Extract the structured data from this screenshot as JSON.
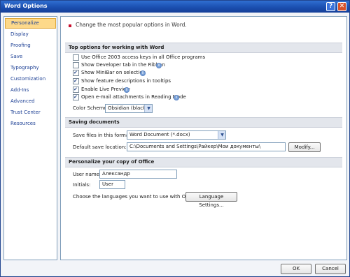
{
  "window": {
    "title": "Word Options",
    "help_label": "?",
    "close_label": "✕"
  },
  "sidebar": {
    "items": [
      {
        "label": "Personalize"
      },
      {
        "label": "Display"
      },
      {
        "label": "Proofing"
      },
      {
        "label": "Save"
      },
      {
        "label": "Typography"
      },
      {
        "label": "Customization"
      },
      {
        "label": "Add-Ins"
      },
      {
        "label": "Advanced"
      },
      {
        "label": "Trust Center"
      },
      {
        "label": "Resources"
      }
    ],
    "active_index": 0
  },
  "intro": "Change the most popular options in Word.",
  "top_options": {
    "heading": "Top options for working with Word",
    "checkboxes": [
      {
        "label": "Use Office 2003 access keys in all Office programs",
        "checked": false,
        "info": false
      },
      {
        "label": "Show Developer tab in the Ribbon",
        "checked": false,
        "info": true
      },
      {
        "label": "Show MiniBar on selection",
        "checked": true,
        "info": true
      },
      {
        "label": "Show feature descriptions in tooltips",
        "checked": true,
        "info": false
      },
      {
        "label": "Enable Live Preview",
        "checked": true,
        "info": true
      },
      {
        "label": "Open e-mail attachments in Reading Mode",
        "checked": true,
        "info": true
      }
    ],
    "color_scheme_label": "Color Scheme:",
    "color_scheme_value": "Obsidian (black)"
  },
  "saving": {
    "heading": "Saving documents",
    "format_label": "Save files in this format:",
    "format_value": "Word Document (*.docx)",
    "location_label": "Default save location:",
    "location_value": "C:\\Documents and Settings\\Райкер\\Мои документы\\",
    "modify_label": "Modify..."
  },
  "personalize": {
    "heading": "Personalize your copy of Office",
    "username_label": "User name:",
    "username_value": "Александр",
    "initials_label": "Initials:",
    "initials_value": "User",
    "languages_label": "Choose the languages you want to use with Office",
    "language_settings_label": "Language Settings..."
  },
  "footer": {
    "ok_label": "OK",
    "cancel_label": "Cancel"
  }
}
